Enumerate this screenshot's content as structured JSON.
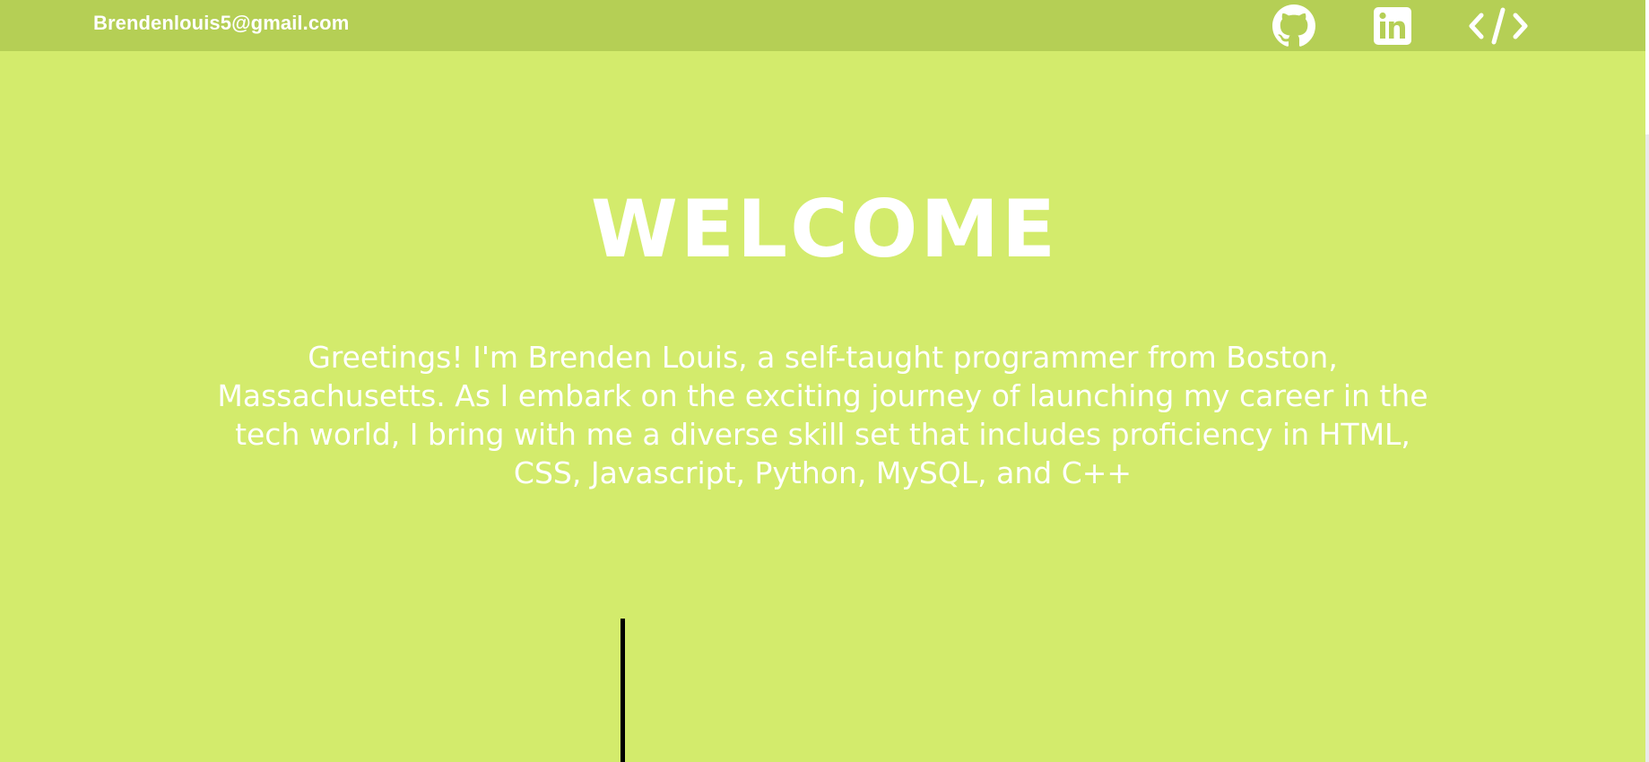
{
  "header": {
    "email": "Brendenlouis5@gmail.com",
    "links": [
      {
        "icon": "github-icon",
        "label": "GitHub"
      },
      {
        "icon": "linkedin-icon",
        "label": "LinkedIn"
      },
      {
        "icon": "code-icon",
        "label": "Code"
      }
    ]
  },
  "hero": {
    "title": "WELCOME",
    "intro": "Greetings! I'm Brenden Louis, a self-taught programmer from Boston, Massachusetts. As I embark on the exciting journey of launching my career in the tech world, I bring with me a diverse skill set that includes proficiency in HTML, CSS, Javascript, Python, MySQL, and C++"
  },
  "colors": {
    "background": "#d3eb6c",
    "topbar": "#b5cf55",
    "text": "#ffffff",
    "divider": "#000000"
  }
}
